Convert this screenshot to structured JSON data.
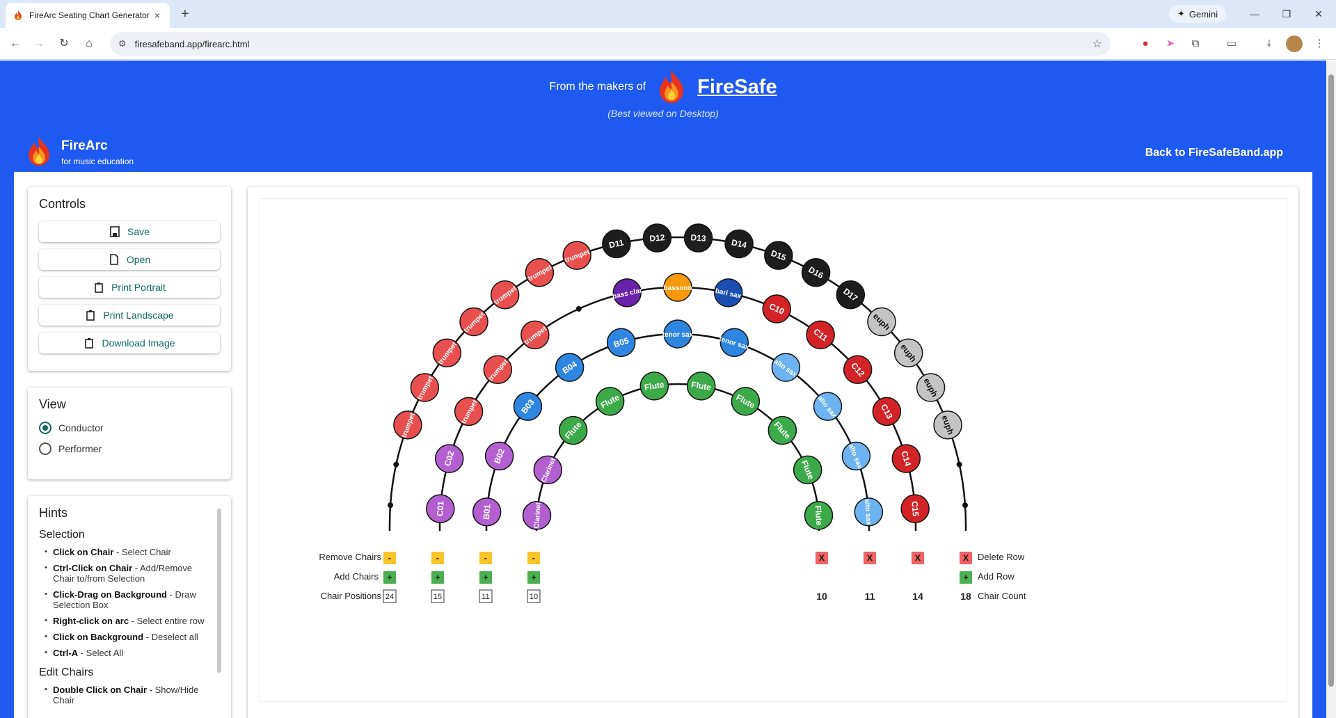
{
  "browser": {
    "tab_title": "FireArc Seating Chart Generator",
    "tab_close": "×",
    "new_tab": "+",
    "gemini": "Gemini",
    "url": "firesafeband.app/firearc.html",
    "win_min": "—",
    "win_max": "❐",
    "win_close": "✕"
  },
  "promo": {
    "lead": "From the makers of",
    "brand": "FireSafe",
    "sub": "(Best viewed on Desktop)"
  },
  "header": {
    "app_name": "FireArc",
    "tagline": "for music education",
    "back_link": "Back to FireSafeBand.app"
  },
  "controls": {
    "title": "Controls",
    "buttons": [
      "Save",
      "Open",
      "Print Portrait",
      "Print Landscape",
      "Download Image"
    ]
  },
  "view": {
    "title": "View",
    "options": [
      "Conductor",
      "Performer"
    ],
    "selected": "Conductor"
  },
  "hints": {
    "title": "Hints",
    "selection_title": "Selection",
    "selection": [
      {
        "key": "Click on Chair",
        "desc": " - Select Chair"
      },
      {
        "key": "Ctrl-Click on Chair",
        "desc": " - Add/Remove Chair to/from Selection"
      },
      {
        "key": "Click-Drag on Background",
        "desc": " - Draw Selection Box"
      },
      {
        "key": "Right-click on arc",
        "desc": " - Select entire row"
      },
      {
        "key": "Click on Background",
        "desc": " - Deselect all"
      },
      {
        "key": "Ctrl-A",
        "desc": " - Select All"
      }
    ],
    "edit_title": "Edit Chairs",
    "edit": [
      {
        "key": "Double Click on Chair",
        "desc": " - Show/Hide Chair"
      }
    ]
  },
  "colors": {
    "page_blue": "#1f5af0",
    "trumpet": "#e8504f",
    "dark": "#1d1d1d",
    "purple": "#b35fd0",
    "blue": "#2e86e0",
    "lightblue": "#6db3f2",
    "green": "#3caa48",
    "gray": "#c4c4c4",
    "red": "#d22427",
    "orange": "#f59a0c",
    "violet": "#6a22a8",
    "navy": "#1a4fb0",
    "remove": "#f7c42a",
    "add": "#4caf50",
    "delete": "#f06262",
    "accent": "#0f6b5f"
  },
  "seating": {
    "labels": {
      "remove": "Remove Chairs",
      "add": "Add Chairs",
      "positions": "Chair Positions",
      "delete_row": "Delete Row",
      "add_row": "Add Row",
      "chair_count": "Chair Count"
    },
    "row_controls": {
      "remove_symbol": "-",
      "add_symbol": "+",
      "delete_symbol": "X",
      "positions": [
        "24",
        "15",
        "11",
        "10"
      ],
      "counts": [
        "10",
        "11",
        "14",
        "18"
      ]
    },
    "rows": [
      {
        "name": "row-4",
        "chairs": [
          {
            "label": "",
            "color": "dot"
          },
          {
            "label": "",
            "color": "dot"
          },
          {
            "label": "trumpet",
            "color": "trumpet"
          },
          {
            "label": "trumpet",
            "color": "trumpet"
          },
          {
            "label": "trumpet",
            "color": "trumpet"
          },
          {
            "label": "trumpet",
            "color": "trumpet"
          },
          {
            "label": "trumpet",
            "color": "trumpet"
          },
          {
            "label": "trumpet",
            "color": "trumpet"
          },
          {
            "label": "trumpet",
            "color": "trumpet"
          },
          {
            "label": "D11",
            "color": "dark"
          },
          {
            "label": "D12",
            "color": "dark"
          },
          {
            "label": "D13",
            "color": "dark"
          },
          {
            "label": "D14",
            "color": "dark"
          },
          {
            "label": "D15",
            "color": "dark"
          },
          {
            "label": "D16",
            "color": "dark"
          },
          {
            "label": "D17",
            "color": "dark"
          },
          {
            "label": "euph",
            "color": "gray"
          },
          {
            "label": "euph",
            "color": "gray"
          },
          {
            "label": "euph",
            "color": "gray"
          },
          {
            "label": "euph",
            "color": "gray"
          },
          {
            "label": "",
            "color": "dot"
          },
          {
            "label": "",
            "color": "dot"
          }
        ]
      },
      {
        "name": "row-3",
        "chairs": [
          {
            "label": "C01",
            "color": "purple"
          },
          {
            "label": "C02",
            "color": "purple"
          },
          {
            "label": "trumpet",
            "color": "trumpet"
          },
          {
            "label": "trumpet",
            "color": "trumpet"
          },
          {
            "label": "trumpet",
            "color": "trumpet"
          },
          {
            "label": "",
            "color": "dot"
          },
          {
            "label": "bass clar",
            "color": "violet"
          },
          {
            "label": "bassoon",
            "color": "orange"
          },
          {
            "label": "bari sax",
            "color": "navy"
          },
          {
            "label": "C10",
            "color": "red"
          },
          {
            "label": "C11",
            "color": "red"
          },
          {
            "label": "C12",
            "color": "red"
          },
          {
            "label": "C13",
            "color": "red"
          },
          {
            "label": "C14",
            "color": "red"
          },
          {
            "label": "C15",
            "color": "red"
          }
        ]
      },
      {
        "name": "row-2",
        "chairs": [
          {
            "label": "B01",
            "color": "purple"
          },
          {
            "label": "B02",
            "color": "purple"
          },
          {
            "label": "B03",
            "color": "blue"
          },
          {
            "label": "B04",
            "color": "blue"
          },
          {
            "label": "B05",
            "color": "blue"
          },
          {
            "label": "tenor sax",
            "color": "blue"
          },
          {
            "label": "tenor sax",
            "color": "blue"
          },
          {
            "label": "alto sax",
            "color": "lightblue"
          },
          {
            "label": "alto sax",
            "color": "lightblue"
          },
          {
            "label": "alto sax",
            "color": "lightblue"
          },
          {
            "label": "alto sax",
            "color": "lightblue"
          }
        ]
      },
      {
        "name": "row-1",
        "chairs": [
          {
            "label": "Clarinet",
            "color": "purple"
          },
          {
            "label": "Clarinet",
            "color": "purple"
          },
          {
            "label": "Flute",
            "color": "green"
          },
          {
            "label": "Flute",
            "color": "green"
          },
          {
            "label": "Flute",
            "color": "green"
          },
          {
            "label": "Flute",
            "color": "green"
          },
          {
            "label": "Flute",
            "color": "green"
          },
          {
            "label": "Flute",
            "color": "green"
          },
          {
            "label": "Flute",
            "color": "green"
          },
          {
            "label": "Flute",
            "color": "green"
          }
        ]
      }
    ]
  }
}
